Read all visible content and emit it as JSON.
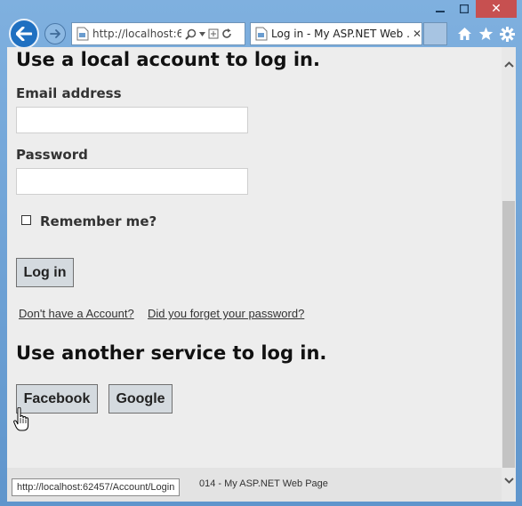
{
  "window": {
    "minimize_icon": "minimize-icon",
    "maximize_icon": "maximize-icon",
    "close_icon": "close-icon",
    "close_glyph": "✕",
    "accent": "#1f70c1",
    "close_color": "#c75050"
  },
  "toolbar": {
    "address_url": "http://localhost:62457",
    "tab_title": "Log in - My ASP.NET Web ...",
    "tab_close": "✕",
    "icons": [
      "back-arrow-icon",
      "forward-arrow-icon",
      "search-icon",
      "dropdown-icon",
      "compatibility-icon",
      "refresh-icon",
      "home-icon",
      "favorites-star-icon",
      "settings-gear-icon"
    ]
  },
  "form": {
    "heading": "Use a local account to log in.",
    "email_label": "Email address",
    "email_value": "",
    "password_label": "Password",
    "password_value": "",
    "remember_label": "Remember me?",
    "remember_checked": false,
    "login_button": "Log in",
    "register_link": "Don't have a Account?",
    "forgot_link": "Did you forget your password?"
  },
  "external": {
    "heading": "Use another service to log in.",
    "providers": [
      "Facebook",
      "Google"
    ]
  },
  "footer": {
    "text": "014 - My ASP.NET Web Page"
  },
  "status_bar": {
    "url": "http://localhost:62457/Account/Login"
  }
}
